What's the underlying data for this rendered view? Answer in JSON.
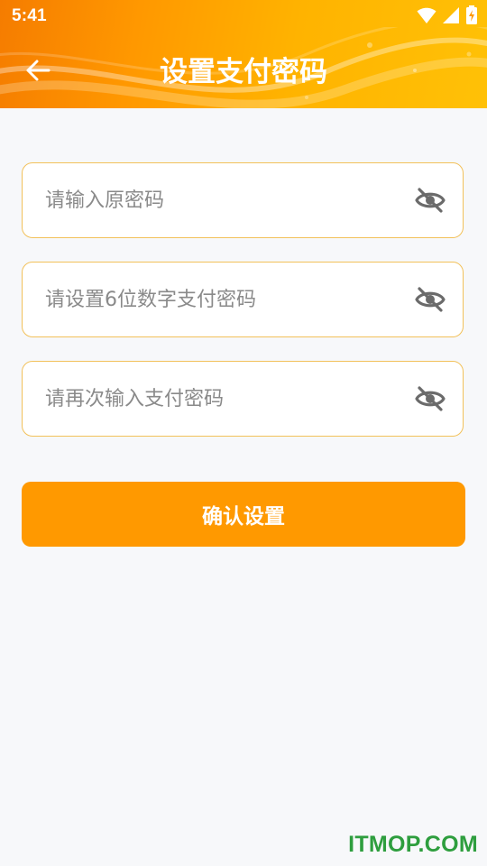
{
  "status_bar": {
    "time": "5:41",
    "icons": [
      "wifi-icon",
      "signal-icon",
      "battery-charging-icon"
    ]
  },
  "header": {
    "title": "设置支付密码",
    "back_icon": "arrow-left-icon",
    "gradient_colors": [
      "#f57c00",
      "#ff9800",
      "#ffb300",
      "#ffc107"
    ]
  },
  "form": {
    "fields": [
      {
        "placeholder": "请输入原密码",
        "value": "",
        "icon": "eye-off-icon"
      },
      {
        "placeholder": "请设置6位数字支付密码",
        "value": "",
        "icon": "eye-off-icon"
      },
      {
        "placeholder": "请再次输入支付密码",
        "value": "",
        "icon": "eye-off-icon"
      }
    ],
    "confirm_label": "确认设置"
  },
  "watermark": "ITMOP.COM",
  "colors": {
    "accent": "#ff9900",
    "field_border": "#f2c15a",
    "background": "#f7f8fa",
    "watermark": "#2e9e3e",
    "icon": "#6b6b6b"
  }
}
